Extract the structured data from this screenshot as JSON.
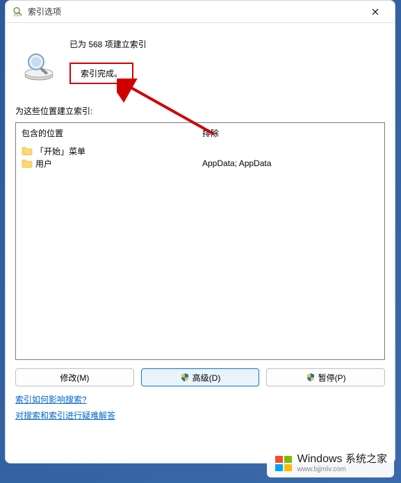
{
  "titlebar": {
    "title": "索引选项"
  },
  "status": {
    "count_line": "已为 568 项建立索引",
    "complete": "索引完成。"
  },
  "section_label": "为这些位置建立索引:",
  "columns": {
    "included": "包含的位置",
    "excluded": "排除"
  },
  "rows": [
    {
      "label": "「开始」菜单",
      "exclude": ""
    },
    {
      "label": "用户",
      "exclude": "AppData; AppData"
    }
  ],
  "buttons": {
    "modify": "修改(M)",
    "advanced": "高级(D)",
    "pause": "暂停(P)"
  },
  "links": {
    "how_affect": "索引如何影响搜索?",
    "troubleshoot": "对搜索和索引进行疑难解答"
  },
  "watermark": {
    "brand": "Windows",
    "brand_cn": "系统之家",
    "url": "www.bjjmlv.com"
  }
}
